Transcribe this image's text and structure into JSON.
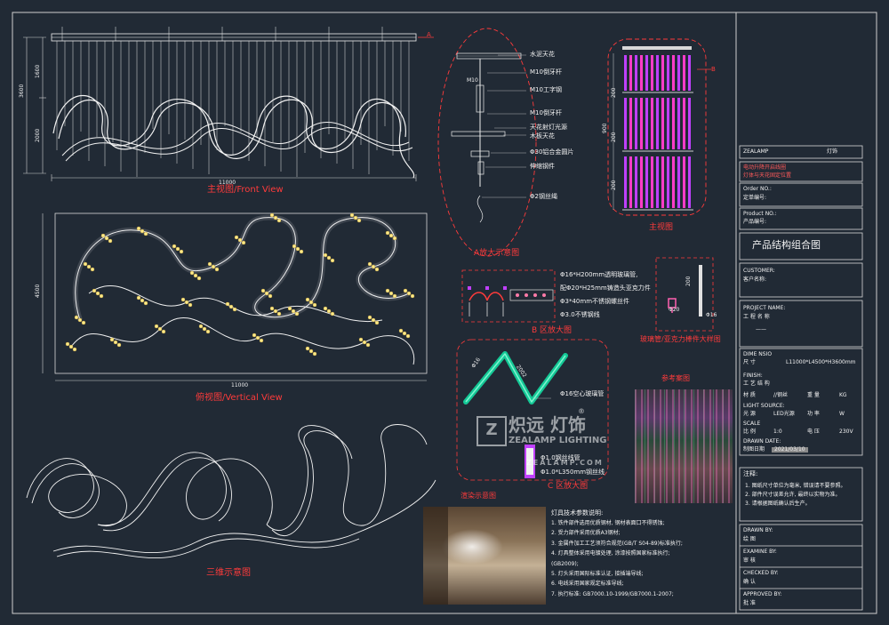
{
  "views": {
    "front_view_title": "主视图/Front View",
    "vertical_view_title": "俯视图/Vertical View",
    "three_d_title": "三维示意图",
    "enlarge_a_title": "A放大示意图",
    "enlarge_b_title": "B 区放大图",
    "enlarge_c_title": "C 区放大图",
    "glass_tube_title": "玻璃管/亚克力棒件大样图",
    "reference_title": "参考案图",
    "rendering_title": "渲染示意图",
    "main_view_title": "主视图",
    "marker_a": "A",
    "marker_b": "B"
  },
  "dimensions": {
    "front_width": "11000",
    "front_height_total": "3600",
    "front_upper": "1600",
    "front_lower": "2000",
    "plan_width": "11000",
    "plan_depth": "4500",
    "mv_900": "900",
    "mv_200a": "200",
    "mv_200b": "200",
    "mv_200c": "200",
    "glass_200": "200",
    "glass_phi20": "Φ20",
    "glass_phi16": "Φ16",
    "c_phi16": "Φ16",
    "c_2002": "2002"
  },
  "callouts_a": [
    "水泥天花",
    "M10倒牙杆",
    "M10工字钢",
    "M10倒牙杆",
    "天花射灯光源",
    "木板天花",
    "Φ30铝合金圆片",
    "伸缩钢件",
    "Φ2钢丝绳"
  ],
  "callout_a_left": "M10",
  "callouts_b": [
    "Φ16*H200mm透明玻璃管,",
    "配Φ20*H25mm铸造头亚克力件",
    "Φ3*40mm不锈钢螺丝件",
    "Φ3.0不锈钢线"
  ],
  "callouts_c": [
    "Φ16空心玻璃管",
    "Φ1.0钢丝线管",
    "Φ1.0*L350mm钢丝线"
  ],
  "watermark": {
    "logo_cn": "炽远 灯饰",
    "logo_en": "ZEALAMP LIGHTING",
    "site": "ZEALAMP.COM",
    "reg": "®"
  },
  "title_block": {
    "header_left": "ZEALAMP",
    "header_right": "灯饰",
    "legend_1": "电动升降开启线圈",
    "legend_2": "灯体与天花固定位置",
    "order_no_label": "Order NO.:",
    "order_no_cn": "定单编号:",
    "product_no_label": "Product NO.:",
    "product_no_cn": "产品编号:",
    "drawing_name": "产品结构组合图",
    "customer_label": "CUSTOMER:",
    "customer_cn": "客户名称:",
    "project_label": "PROJECT NAME:",
    "project_cn": "工  程  名  称",
    "project_value": "——",
    "size_label_en": "DIME NSIO",
    "size_label_cn": "尺  寸",
    "size_value": "L11000*L4500*H3600mm",
    "finish_label_en": "FINISH:",
    "finish_label_cn": "工 艺 结 构",
    "material_label": "材    质",
    "material_value": "//钢丝",
    "weight_label": "重    量",
    "weight_value": "KG",
    "light_label_en": "LIGHT SOURCE:",
    "light_label_cn": "光    源",
    "light_value": "LED光源",
    "power_label": "功    率",
    "power_value": "W",
    "scale_label_en": "SCALE",
    "scale_label_cn": "比    例",
    "scale_value": "1:0",
    "voltage_label": "电    压",
    "voltage_value": "230V",
    "date_label_en": "DRAWN DATE:",
    "date_label_cn": "制图日期",
    "date_value": "2021/03/10",
    "notes_label": "注释:",
    "notes": [
      "1. 图纸尺寸单位为毫米, 错误请不要参照。",
      "2. 部件尺寸误差允许, 最终以实物为准。",
      "3. 请根据图纸确认后生产。"
    ],
    "drawn_by_label": "DRAWN BY:",
    "drawn_by_cn": "绘    图",
    "examine_by_label": "EXAMINE BY:",
    "examine_by_cn": "审    核",
    "checked_by_label": "CHECKED BY:",
    "checked_by_cn": "确    认",
    "approved_by_label": "APPROVED BY:",
    "approved_by_cn": "批    准"
  },
  "requirements": {
    "title": "灯具技术参数说明:",
    "items": [
      "1. 铁件部件选用优质钢材, 钢材表面口不得锈蚀;",
      "2. 受力部件采用优质A3钢材;",
      "3. 金属件加工工艺须符合规范(GB/T S04-89)标准执行;",
      "4. 灯具整体采用电镀处理, 涂漆按照国家标准执行;",
      "   (GB2009);",
      "5. 灯头采用国际标准认证, 接插端导线;",
      "6. 电线采用国家规定标准导线;",
      "7. 执行标准: GB7000.10-1999/GB7000.1-2007;"
    ]
  }
}
